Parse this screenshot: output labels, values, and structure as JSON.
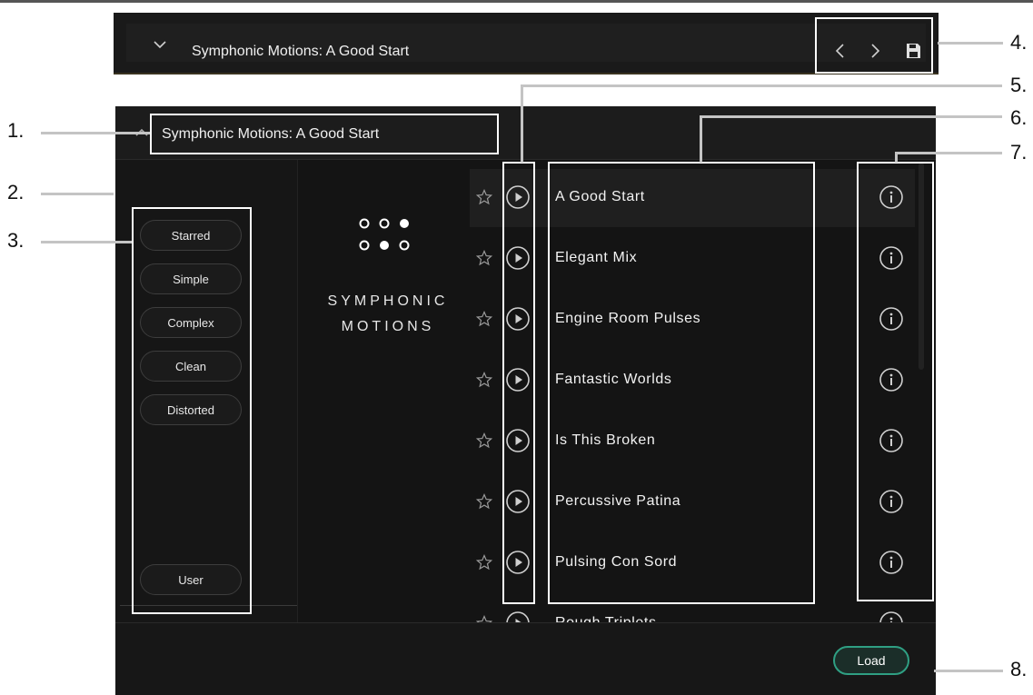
{
  "topbar": {
    "title": "Symphonic Motions: A Good Start",
    "icons": [
      "chevron-down-icon",
      "chevron-left-icon",
      "chevron-right-icon",
      "save-icon"
    ]
  },
  "panel": {
    "title": "Symphonic Motions: A Good Start"
  },
  "filters": [
    "Starred",
    "Simple",
    "Complex",
    "Clean",
    "Distorted"
  ],
  "user_filter": "User",
  "brand": {
    "line1": "SYMPHONIC",
    "line2": "MOTIONS"
  },
  "presets": [
    "A Good Start",
    "Elegant Mix",
    "Engine Room Pulses",
    "Fantastic Worlds",
    "Is This Broken",
    "Percussive Patina",
    "Pulsing Con Sord",
    "Rough Triplets"
  ],
  "footer": {
    "load_label": "Load"
  },
  "callouts": [
    "1.",
    "2.",
    "3.",
    "4.",
    "5.",
    "6.",
    "7.",
    "8."
  ],
  "colors": {
    "accent": "#2f9f83",
    "background": "#141414",
    "highlight": "#ffffff"
  }
}
